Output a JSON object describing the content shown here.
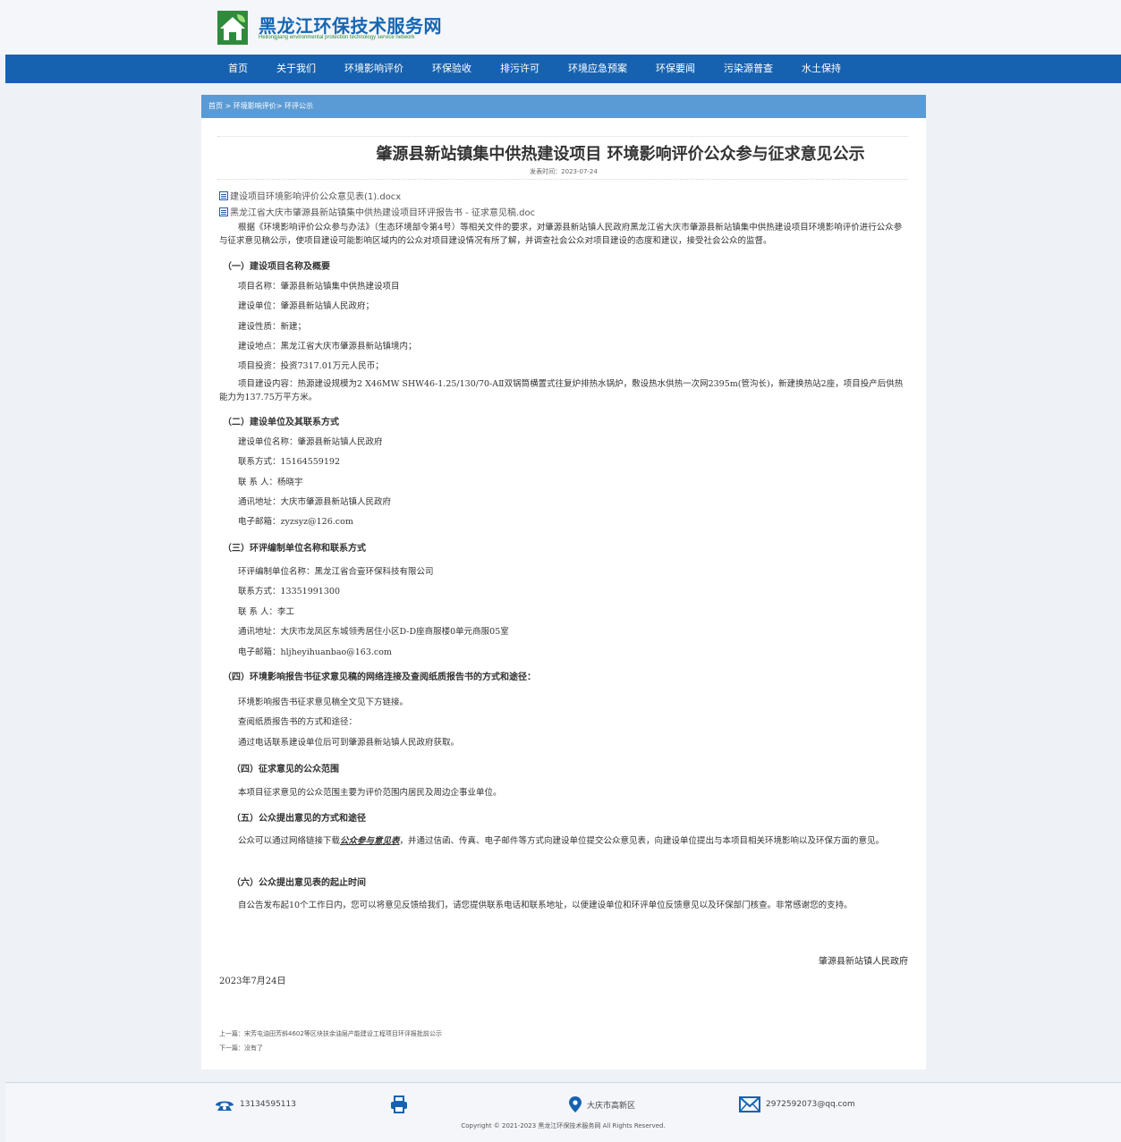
{
  "header": {
    "site_name": "黑龙江环保技术服务网",
    "site_name_en": "Heilongjiang environmental protection technology service network"
  },
  "nav": [
    "首页",
    "关于我们",
    "环境影响评价",
    "环保验收",
    "排污许可",
    "环境应急预案",
    "环保要闻",
    "污染源普查",
    "水土保持"
  ],
  "breadcrumb": "首页 > 环境影响评价> 环评公示",
  "article": {
    "title": "肇源县新站镇集中供热建设项目 环境影响评价公众参与征求意见公示",
    "publish_time": "发表时间：2023-07-24",
    "attachments": [
      "建设项目环境影响评价公众意见表(1).docx",
      "黑龙江省大庆市肇源县新站镇集中供热建设项目环评报告书 - 征求意见稿.doc"
    ],
    "intro": "根据《环境影响评价公众参与办法》（生态环境部令第4号）等相关文件的要求，对肇源县新站镇人民政府黑龙江省大庆市肇源县新站镇集中供热建设项目环境影响评价进行公众参与征求意见稿公示，使项目建设可能影响区域内的公众对项目建设情况有所了解，并调查社会公众对项目建设的态度和建议，接受社会公众的监督。",
    "s1": {
      "heading": "（一）建设项目名称及概要",
      "lines": [
        "项目名称：肇源县新站镇集中供热建设项目",
        "建设单位：肇源县新站镇人民政府；",
        "建设性质：新建；",
        "建设地点：黑龙江省大庆市肇源县新站镇境内；",
        "项目投资：投资7317.01万元人民币；"
      ],
      "content": "项目建设内容：热源建设规模为2 X46MW SHW46-1.25/130/70-AⅡ双锅筒横置式往复炉排热水锅炉，敷设热水供热一次网2395m(管沟长)，新建换热站2座，项目投产后供热能力为137.75万平方米。"
    },
    "s2": {
      "heading": "（二）建设单位及其联系方式",
      "lines": [
        "建设单位名称：肇源县新站镇人民政府",
        "联系方式：15164559192",
        "联 系 人：杨晓宇",
        "通讯地址：大庆市肇源县新站镇人民政府",
        "电子邮箱：zyzsyz@126.com"
      ]
    },
    "s3": {
      "heading": "（三）环评编制单位名称和联系方式",
      "lines": [
        "环评编制单位名称：黑龙江省合壹环保科技有限公司",
        "联系方式：13351991300",
        "联 系 人：李工",
        "通讯地址：大庆市龙凤区东城领秀居住小区D-D座商服楼0单元商服05室",
        "电子邮箱：hljheyihuanbao@163.com"
      ]
    },
    "s4": {
      "heading": "（四）环境影响报告书征求意见稿的网络连接及查阅纸质报告书的方式和途径：",
      "lines": [
        "环境影响报告书征求意见稿全文见下方链接。",
        "查阅纸质报告书的方式和途径：",
        "通过电话联系建设单位后可到肇源县新站镇人民政府获取。"
      ]
    },
    "s5": {
      "heading": "（四）征求意见的公众范围",
      "lines": [
        "本项目征求意见的公众范围主要为评价范围内居民及周边企事业单位。"
      ]
    },
    "s6": {
      "heading": "（五）公众提出意见的方式和途径",
      "text_before": "公众可以通过网络链接下载",
      "link": "公众参与意见表",
      "text_after": "，并通过信函、传真、电子邮件等方式向建设单位提交公众意见表，向建设单位提出与本项目相关环境影响以及环保方面的意见。"
    },
    "s7": {
      "heading": "（六）公众提出意见表的起止时间",
      "text": "自公告发布起10个工作日内，您可以将意见反馈给我们，请您提供联系电话和联系地址，以便建设单位和环评单位反馈意见以及环保部门核查。非常感谢您的支持。"
    },
    "signature": "肇源县新站镇人民政府",
    "date": "2023年7月24日",
    "prev": "上一篇：宋芳屯油田芳斜4602等区块扶余油层产能建设工程项目环评报批前公示",
    "next": "下一篇：没有了"
  },
  "footer": {
    "phone": "13134595113",
    "address": "大庆市高新区",
    "email": "2972592073@qq.com",
    "copyright": "Copyright © 2021-2023 黑龙江环保技术服务网   All Rights Reserved.",
    "colors": {
      "primary": "#1762b0",
      "logo_green": "#2f8a3c"
    }
  }
}
